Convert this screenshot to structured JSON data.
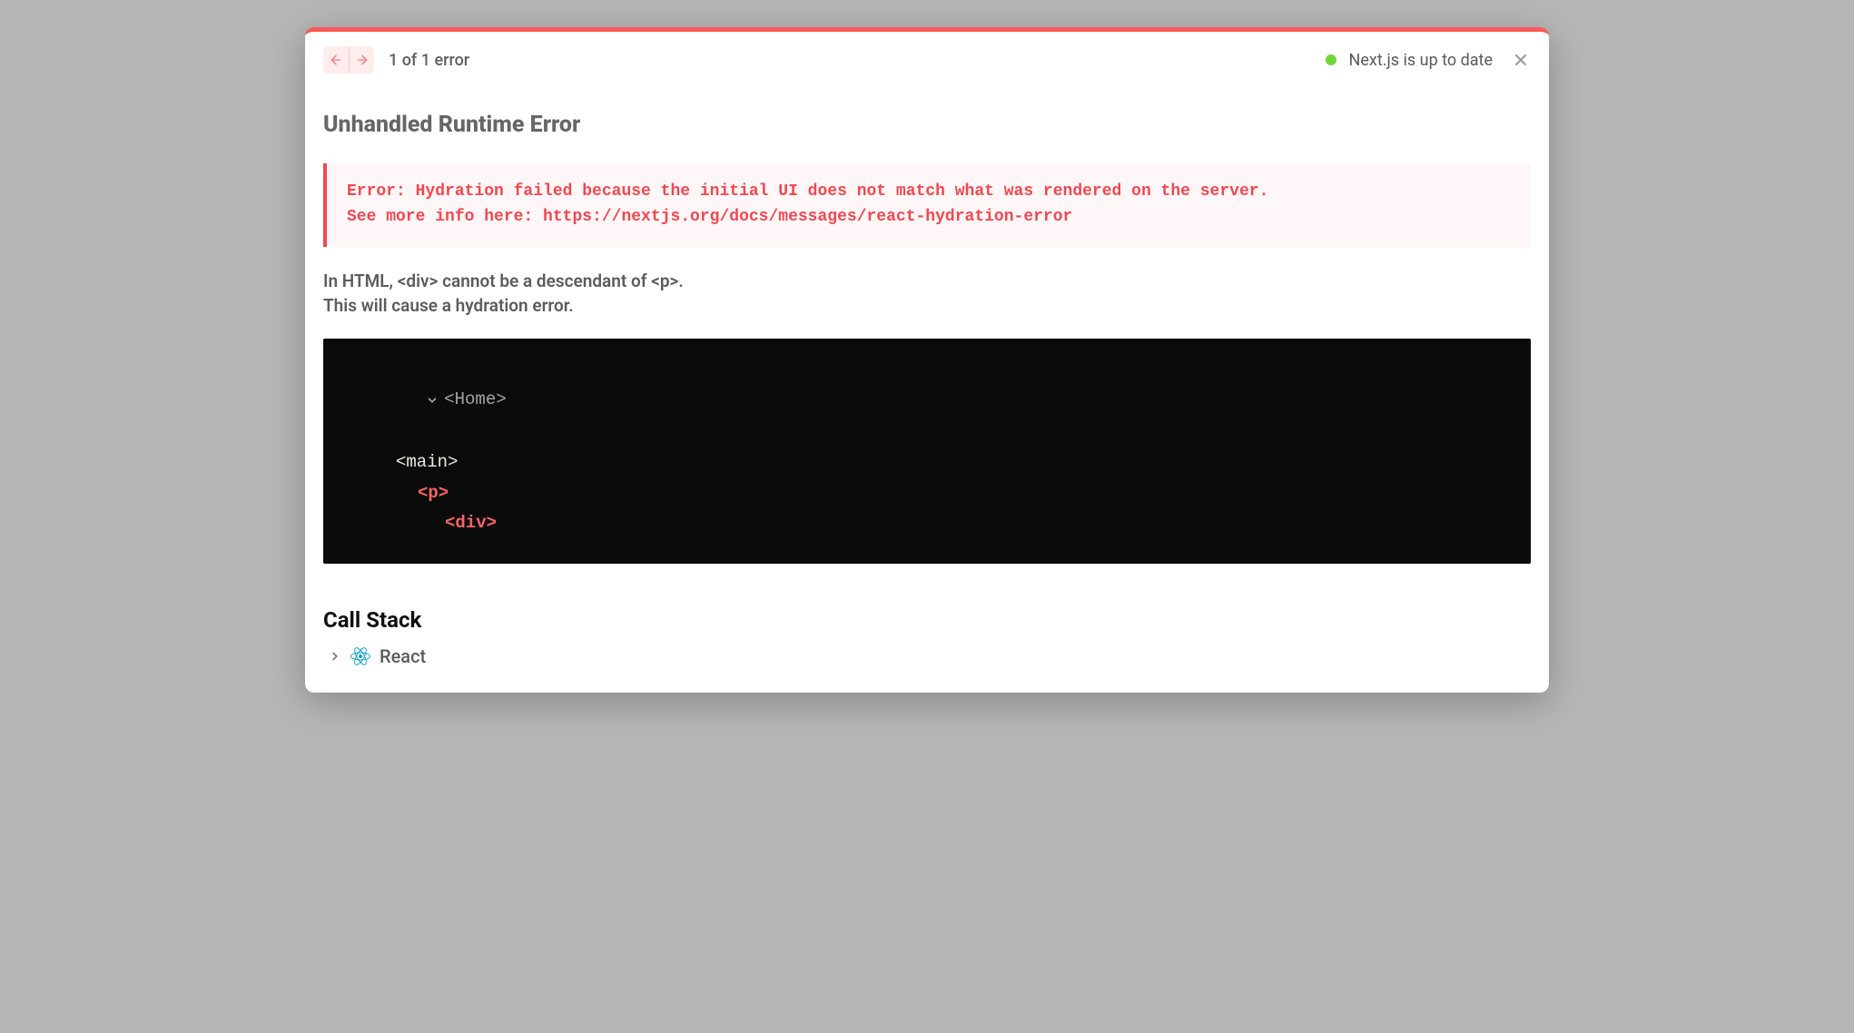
{
  "header": {
    "counter_text": "1 of 1 error",
    "status_text": "Next.js is up to date"
  },
  "error": {
    "title": "Unhandled Runtime Error",
    "message": "Error: Hydration failed because the initial UI does not match what was rendered on the server.\nSee more info here: https://nextjs.org/docs/messages/react-hydration-error",
    "explanation": "In HTML, <div> cannot be a descendant of <p>.\nThis will cause a hydration error."
  },
  "tree": {
    "root": "<Home>",
    "lines": {
      "main": "<main>",
      "p": "<p>",
      "div": "<div>"
    }
  },
  "callstack": {
    "title": "Call Stack",
    "items": [
      {
        "label": "React"
      }
    ]
  }
}
